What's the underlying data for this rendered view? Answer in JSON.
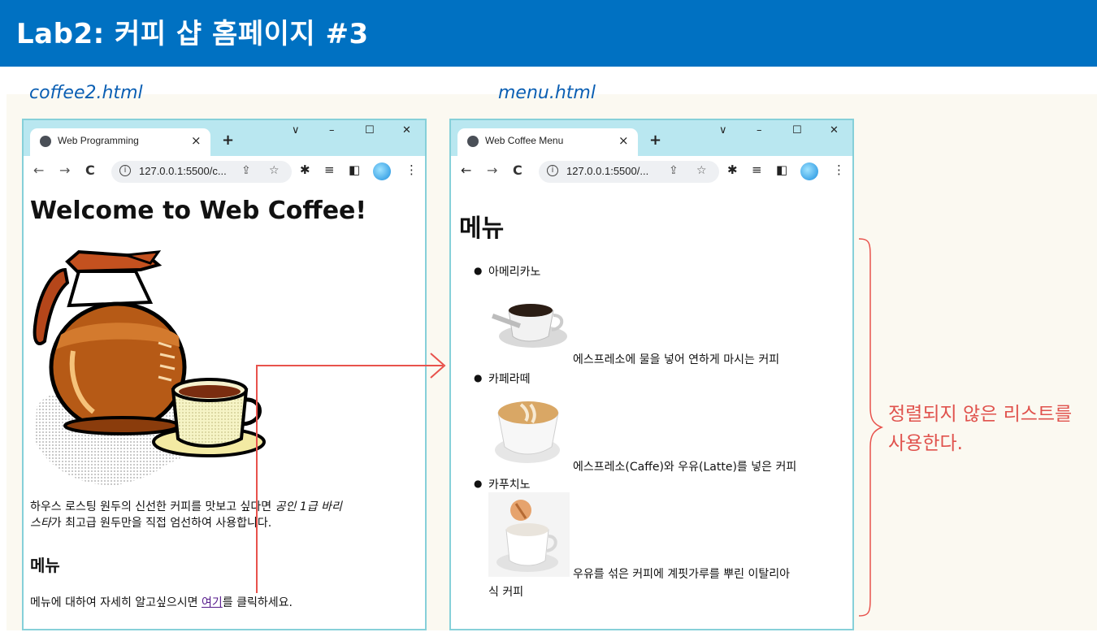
{
  "slide": {
    "title": "Lab2: 커피 샵 홈페이지 #3",
    "left_label": "coffee2.html",
    "right_label": "menu.html",
    "annotation_line1": "정렬되지 않은 리스트를",
    "annotation_line2": "사용한다.",
    "accent_color": "#0071c2",
    "annotation_color": "#e0524d"
  },
  "left_browser": {
    "tab_title": "Web Programming",
    "tab_close": "×",
    "new_tab": "+",
    "url": "127.0.0.1:5500/c...",
    "page": {
      "heading": "Welcome to Web Coffee!",
      "para_line1_normal": "하우스 로스팅 원두의 신선한 커피를 맛보고 싶다면 ",
      "para_line1_italic": "공인 1급 바리",
      "para_line2_italic": "스타",
      "para_line2_normal": "가 최고급 원두만을 직접 엄선하여 사용합니다.",
      "menu_heading": "메뉴",
      "menu_text_before": "메뉴에 대하여 자세히 알고싶으시면 ",
      "menu_link": "여기",
      "menu_text_after": "를 클릭하세요."
    }
  },
  "right_browser": {
    "tab_title": "Web Coffee Menu",
    "tab_close": "×",
    "new_tab": "+",
    "url": "127.0.0.1:5500/...",
    "page": {
      "heading": "메뉴",
      "items": [
        {
          "name": "아메리카노",
          "desc": "에스프레소에 물을 넣어 연하게 마시는 커피",
          "desc2": ""
        },
        {
          "name": "카페라떼",
          "desc": "에스프레소(Caffe)와 우유(Latte)를 넣은 커피",
          "desc2": ""
        },
        {
          "name": "카푸치노",
          "desc": "우유를 섞은 커피에 계핏가루를 뿌린 이탈리아",
          "desc2": "식 커피"
        }
      ]
    }
  },
  "window_controls": {
    "dropdown": "∨",
    "minimize": "–",
    "maximize": "☐",
    "close": "✕"
  },
  "toolbar_icons": {
    "back": "←",
    "forward": "→",
    "reload": "C",
    "info": "i",
    "share": "⇪",
    "star": "☆",
    "extensions": "✱",
    "reading_list": "≡",
    "side_panel": "◧",
    "menu": "⋮"
  }
}
